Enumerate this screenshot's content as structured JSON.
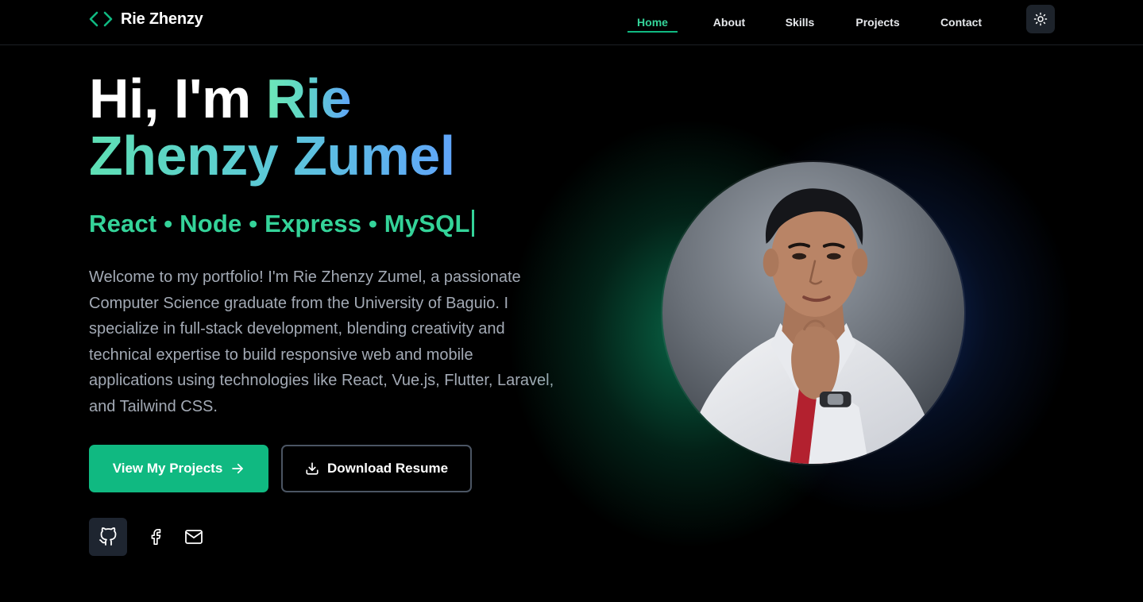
{
  "header": {
    "brand_name": "Rie Zhenzy",
    "brand_icon": "code-brackets-icon",
    "nav": {
      "home": "Home",
      "about": "About",
      "skills": "Skills",
      "projects": "Projects",
      "contact": "Contact"
    },
    "active_nav": "Home",
    "theme_toggle_icon": "sun-icon"
  },
  "hero": {
    "greeting": "Hi, I'm",
    "name_first": "Rie",
    "name_rest": "Zhenzy Zumel",
    "tech_stack": "React • Node • Express • MySQL",
    "intro": "Welcome to my portfolio! I'm Rie Zhenzy Zumel, a passionate Computer Science graduate from the University of Baguio. I specialize in full-stack development, blending creativity and technical expertise to build responsive web and mobile applications using technologies like React, Vue.js, Flutter, Laravel, and Tailwind CSS.",
    "primary_button": "View My Projects",
    "secondary_button": "Download Resume"
  },
  "social": {
    "icons": [
      "github-icon",
      "facebook-icon",
      "mail-icon"
    ]
  },
  "colors": {
    "accent": "#10b981",
    "accent_light": "#34d399",
    "gradient_end": "#60a5fa",
    "background": "#000000",
    "body_text": "#a3aab5"
  }
}
